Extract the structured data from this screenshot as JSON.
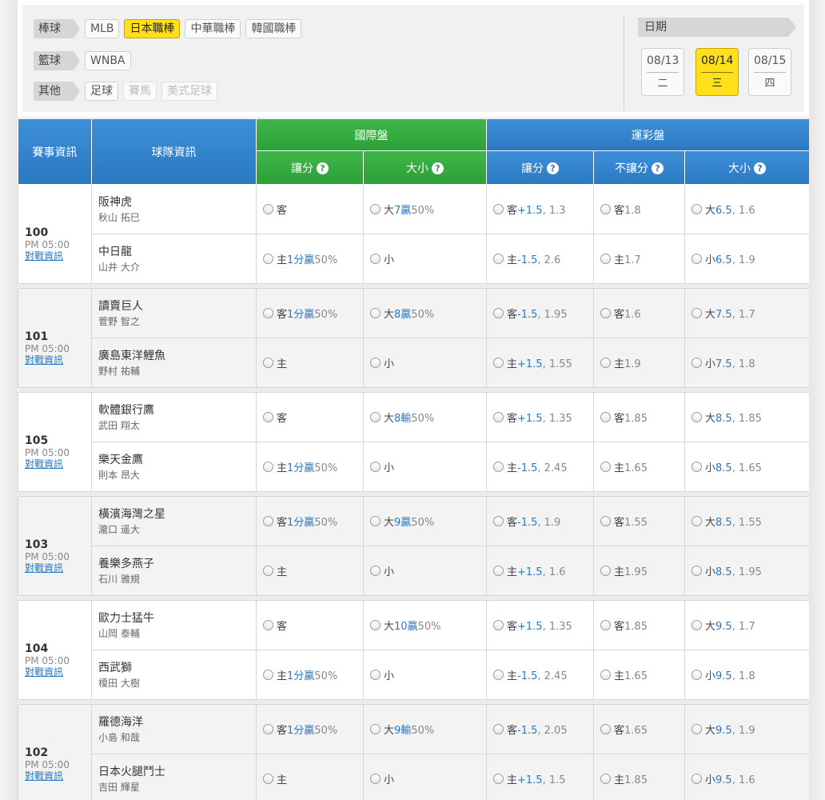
{
  "filters": {
    "rows": [
      {
        "label": "棒球",
        "chips": [
          {
            "text": "MLB",
            "state": "normal"
          },
          {
            "text": "日本職棒",
            "state": "active"
          },
          {
            "text": "中華職棒",
            "state": "normal"
          },
          {
            "text": "韓國職棒",
            "state": "normal"
          }
        ]
      },
      {
        "label": "籃球",
        "chips": [
          {
            "text": "WNBA",
            "state": "normal"
          }
        ]
      },
      {
        "label": "其他",
        "chips": [
          {
            "text": "足球",
            "state": "normal"
          },
          {
            "text": "賽馬",
            "state": "disabled"
          },
          {
            "text": "美式足球",
            "state": "disabled"
          }
        ]
      }
    ],
    "date_label": "日期",
    "dates": [
      {
        "date": "08/13",
        "weekday": "二",
        "active": false
      },
      {
        "date": "08/14",
        "weekday": "三",
        "active": true
      },
      {
        "date": "08/15",
        "weekday": "四",
        "active": false
      }
    ]
  },
  "header": {
    "event_info": "賽事資訊",
    "team_info": "球隊資訊",
    "intl": "國際盤",
    "lottery": "運彩盤",
    "intl_spread": "讓分",
    "intl_total": "大小",
    "lot_spread": "讓分",
    "lot_ml": "不讓分",
    "lot_total": "大小",
    "help": "?"
  },
  "games": [
    {
      "id": "100",
      "time": "PM 05:00",
      "link": "對戰資訊",
      "away": {
        "team": "阪神虎",
        "pitcher": "秋山 拓巳",
        "is": [
          "客",
          "",
          ""
        ],
        "it": [
          "大",
          "7贏",
          "50%"
        ],
        "ls": [
          "客",
          "+1.5",
          ", 1.3"
        ],
        "lm": [
          "客",
          "",
          "1.8"
        ],
        "lt": [
          "大",
          "6.5",
          ", 1.6"
        ]
      },
      "home": {
        "team": "中日龍",
        "pitcher": "山井 大介",
        "is": [
          "主",
          "1分贏",
          "50%"
        ],
        "it": [
          "小",
          "",
          ""
        ],
        "ls": [
          "主",
          "-1.5",
          ", 2.6"
        ],
        "lm": [
          "主",
          "",
          "1.7"
        ],
        "lt": [
          "小",
          "6.5",
          ", 1.9"
        ]
      }
    },
    {
      "id": "101",
      "time": "PM 05:00",
      "link": "對戰資訊",
      "away": {
        "team": "讀賣巨人",
        "pitcher": "菅野 智之",
        "is": [
          "客",
          "1分贏",
          "50%"
        ],
        "it": [
          "大",
          "8贏",
          "50%"
        ],
        "ls": [
          "客",
          "-1.5",
          ", 1.95"
        ],
        "lm": [
          "客",
          "",
          "1.6"
        ],
        "lt": [
          "大",
          "7.5",
          ", 1.7"
        ]
      },
      "home": {
        "team": "廣島東洋鯉魚",
        "pitcher": "野村 祐輔",
        "is": [
          "主",
          "",
          ""
        ],
        "it": [
          "小",
          "",
          ""
        ],
        "ls": [
          "主",
          "+1.5",
          ", 1.55"
        ],
        "lm": [
          "主",
          "",
          "1.9"
        ],
        "lt": [
          "小",
          "7.5",
          ", 1.8"
        ]
      }
    },
    {
      "id": "105",
      "time": "PM 05:00",
      "link": "對戰資訊",
      "away": {
        "team": "軟體銀行鷹",
        "pitcher": "武田 翔太",
        "is": [
          "客",
          "",
          ""
        ],
        "it": [
          "大",
          "8輸",
          "50%"
        ],
        "ls": [
          "客",
          "+1.5",
          ", 1.35"
        ],
        "lm": [
          "客",
          "",
          "1.85"
        ],
        "lt": [
          "大",
          "8.5",
          ", 1.85"
        ]
      },
      "home": {
        "team": "樂天金鷹",
        "pitcher": "則本 昂大",
        "is": [
          "主",
          "1分贏",
          "50%"
        ],
        "it": [
          "小",
          "",
          ""
        ],
        "ls": [
          "主",
          "-1.5",
          ", 2.45"
        ],
        "lm": [
          "主",
          "",
          "1.65"
        ],
        "lt": [
          "小",
          "8.5",
          ", 1.65"
        ]
      }
    },
    {
      "id": "103",
      "time": "PM 05:00",
      "link": "對戰資訊",
      "away": {
        "team": "橫濱海灣之星",
        "pitcher": "瀧口 遥大",
        "is": [
          "客",
          "1分贏",
          "50%"
        ],
        "it": [
          "大",
          "9贏",
          "50%"
        ],
        "ls": [
          "客",
          "-1.5",
          ", 1.9"
        ],
        "lm": [
          "客",
          "",
          "1.55"
        ],
        "lt": [
          "大",
          "8.5",
          ", 1.55"
        ]
      },
      "home": {
        "team": "養樂多燕子",
        "pitcher": "石川 雅規",
        "is": [
          "主",
          "",
          ""
        ],
        "it": [
          "小",
          "",
          ""
        ],
        "ls": [
          "主",
          "+1.5",
          ", 1.6"
        ],
        "lm": [
          "主",
          "",
          "1.95"
        ],
        "lt": [
          "小",
          "8.5",
          ", 1.95"
        ]
      }
    },
    {
      "id": "104",
      "time": "PM 05:00",
      "link": "對戰資訊",
      "away": {
        "team": "歐力士猛牛",
        "pitcher": "山岡 泰輔",
        "is": [
          "客",
          "",
          ""
        ],
        "it": [
          "大",
          "10贏",
          "50%"
        ],
        "ls": [
          "客",
          "+1.5",
          ", 1.35"
        ],
        "lm": [
          "客",
          "",
          "1.85"
        ],
        "lt": [
          "大",
          "9.5",
          ", 1.7"
        ]
      },
      "home": {
        "team": "西武獅",
        "pitcher": "榎田 大樹",
        "is": [
          "主",
          "1分贏",
          "50%"
        ],
        "it": [
          "小",
          "",
          ""
        ],
        "ls": [
          "主",
          "-1.5",
          ", 2.45"
        ],
        "lm": [
          "主",
          "",
          "1.65"
        ],
        "lt": [
          "小",
          "9.5",
          ", 1.8"
        ]
      }
    },
    {
      "id": "102",
      "time": "PM 05:00",
      "link": "對戰資訊",
      "away": {
        "team": "羅德海洋",
        "pitcher": "小島 和哉",
        "is": [
          "客",
          "1分贏",
          "50%"
        ],
        "it": [
          "大",
          "9輸",
          "50%"
        ],
        "ls": [
          "客",
          "-1.5",
          ", 2.05"
        ],
        "lm": [
          "客",
          "",
          "1.65"
        ],
        "lt": [
          "大",
          "9.5",
          ", 1.9"
        ]
      },
      "home": {
        "team": "日本火腿鬥士",
        "pitcher": "吉田 輝星",
        "is": [
          "主",
          "",
          ""
        ],
        "it": [
          "小",
          "",
          ""
        ],
        "ls": [
          "主",
          "+1.5",
          ", 1.5"
        ],
        "lm": [
          "主",
          "",
          "1.85"
        ],
        "lt": [
          "小",
          "9.5",
          ", 1.6"
        ]
      }
    }
  ]
}
